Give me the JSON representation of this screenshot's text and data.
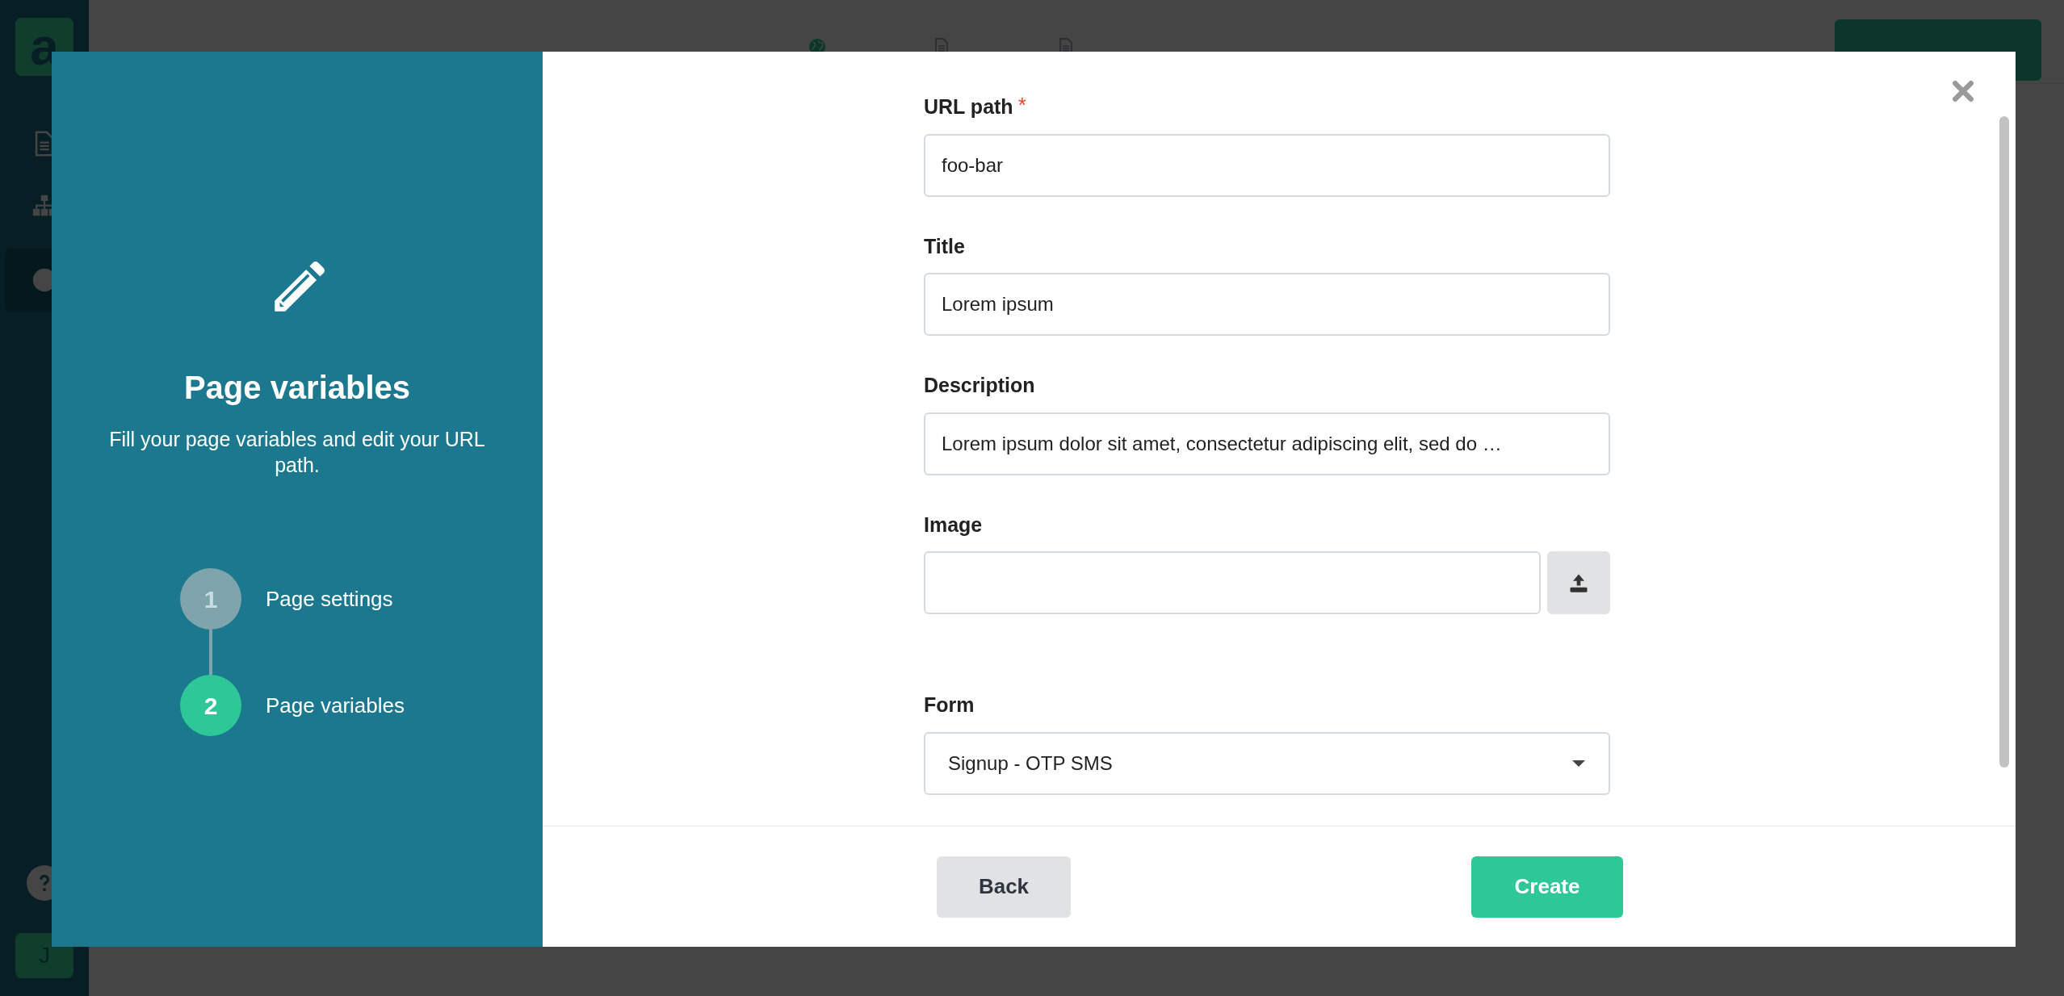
{
  "app": {
    "logo": "a",
    "sidebar": [
      {
        "kind": "document",
        "selected": false
      },
      {
        "kind": "sitemap",
        "selected": false
      },
      {
        "kind": "globe",
        "selected": true
      }
    ],
    "avatar": "J"
  },
  "header": {
    "tabs": [
      {
        "kind": "globe",
        "selected": true
      },
      {
        "kind": "document",
        "selected": false
      },
      {
        "kind": "document",
        "selected": false
      }
    ]
  },
  "modal": {
    "panel": {
      "title": "Page variables",
      "description": "Fill your page variables and edit your URL path.",
      "steps": [
        {
          "number": "1",
          "label": "Page settings",
          "selected": false
        },
        {
          "number": "2",
          "label": "Page variables",
          "selected": true
        }
      ]
    },
    "fields": [
      {
        "kind": "text",
        "label": "URL path",
        "required_mark": "*",
        "value": "foo-bar"
      },
      {
        "kind": "text",
        "label": "Title",
        "value": "Lorem ipsum"
      },
      {
        "kind": "text",
        "label": "Description",
        "value": "Lorem ipsum dolor sit amet, consectetur adipiscing elit, sed do …"
      },
      {
        "kind": "file",
        "label": "Image"
      },
      {
        "kind": "select",
        "label": "Form",
        "value": "Signup - OTP SMS"
      }
    ],
    "back": "Back",
    "create": "Create"
  }
}
